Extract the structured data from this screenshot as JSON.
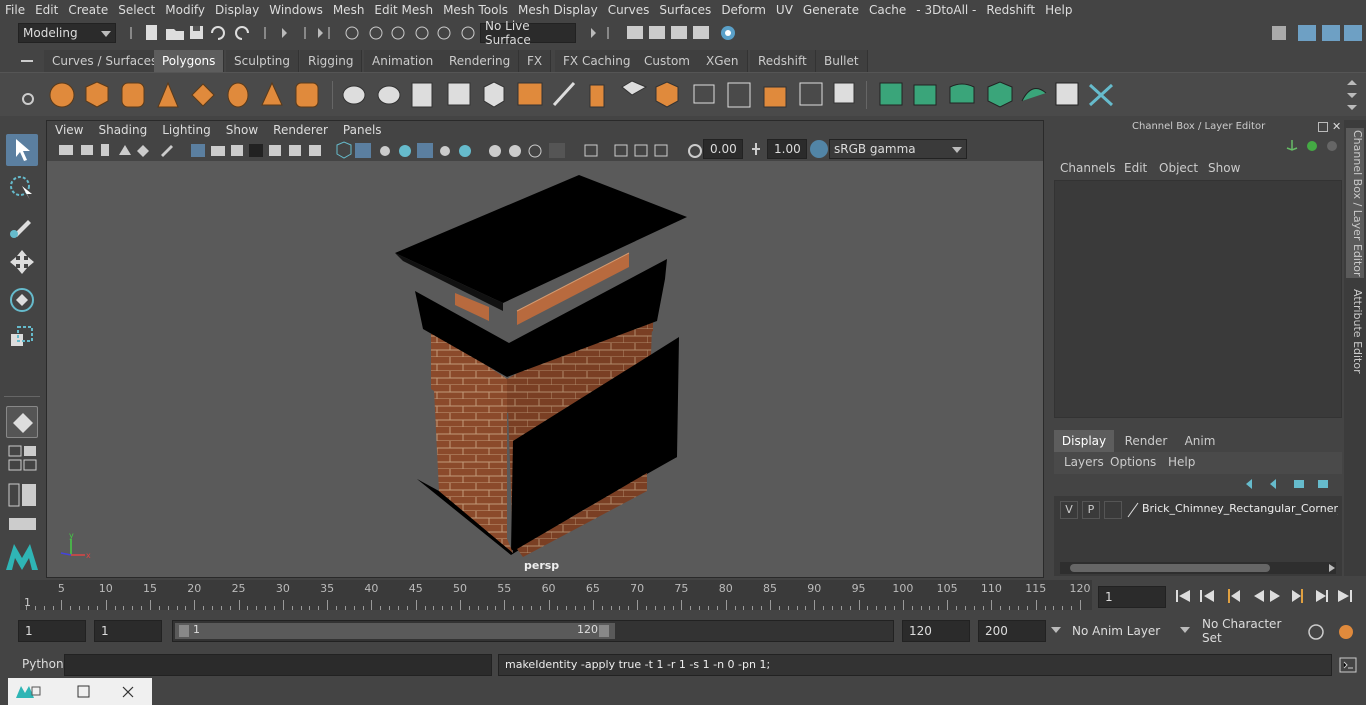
{
  "menubar": [
    "File",
    "Edit",
    "Create",
    "Select",
    "Modify",
    "Display",
    "Windows",
    "Mesh",
    "Edit Mesh",
    "Mesh Tools",
    "Mesh Display",
    "Curves",
    "Surfaces",
    "Deform",
    "UV",
    "Generate",
    "Cache",
    "- 3DtoAll -",
    "Redshift",
    "Help"
  ],
  "status": {
    "mode": "Modeling",
    "live_surface": "No Live Surface"
  },
  "shelf_tabs": [
    "Curves / Surfaces",
    "Polygons",
    "Sculpting",
    "Rigging",
    "Animation",
    "Rendering",
    "FX",
    "FX Caching",
    "Custom",
    "XGen",
    "Redshift",
    "Bullet"
  ],
  "shelf_active": "Polygons",
  "viewport": {
    "menus": [
      "View",
      "Shading",
      "Lighting",
      "Show",
      "Renderer",
      "Panels"
    ],
    "exposure": "0.00",
    "gamma": "1.00",
    "colorspace": "sRGB gamma",
    "camera": "persp"
  },
  "channel_box": {
    "title": "Channel Box / Layer Editor",
    "menus": [
      "Channels",
      "Edit",
      "Object",
      "Show"
    ],
    "layer_tabs": [
      "Display",
      "Render",
      "Anim"
    ],
    "layer_menus": [
      "Layers",
      "Options",
      "Help"
    ],
    "layer": {
      "v": "V",
      "p": "P",
      "name": "Brick_Chimney_Rectangular_Corner_Ba"
    }
  },
  "side_tabs": [
    "Channel Box / Layer Editor",
    "Attribute Editor"
  ],
  "timeline": {
    "ticks": [
      "5",
      "10",
      "15",
      "20",
      "25",
      "30",
      "35",
      "40",
      "45",
      "50",
      "55",
      "60",
      "65",
      "70",
      "75",
      "80",
      "85",
      "90",
      "95",
      "100",
      "105",
      "110",
      "115",
      "120"
    ],
    "start_marker": "1",
    "current_frame": "1"
  },
  "range": {
    "start": "1",
    "playback_start": "1",
    "slider_start": "1",
    "slider_end": "120",
    "playback_end": "120",
    "end": "200",
    "anim_layer": "No Anim Layer",
    "char_set": "No Character Set"
  },
  "cmd": {
    "lang": "Python",
    "output": "makeIdentity -apply true -t 1 -r 1 -s 1 -n 0 -pn 1;"
  },
  "colors": {
    "accent": "#5285a6",
    "brick": "#8b4a2b",
    "shelf_icon": "#e08a3c",
    "green_icon": "#3aa57a"
  }
}
